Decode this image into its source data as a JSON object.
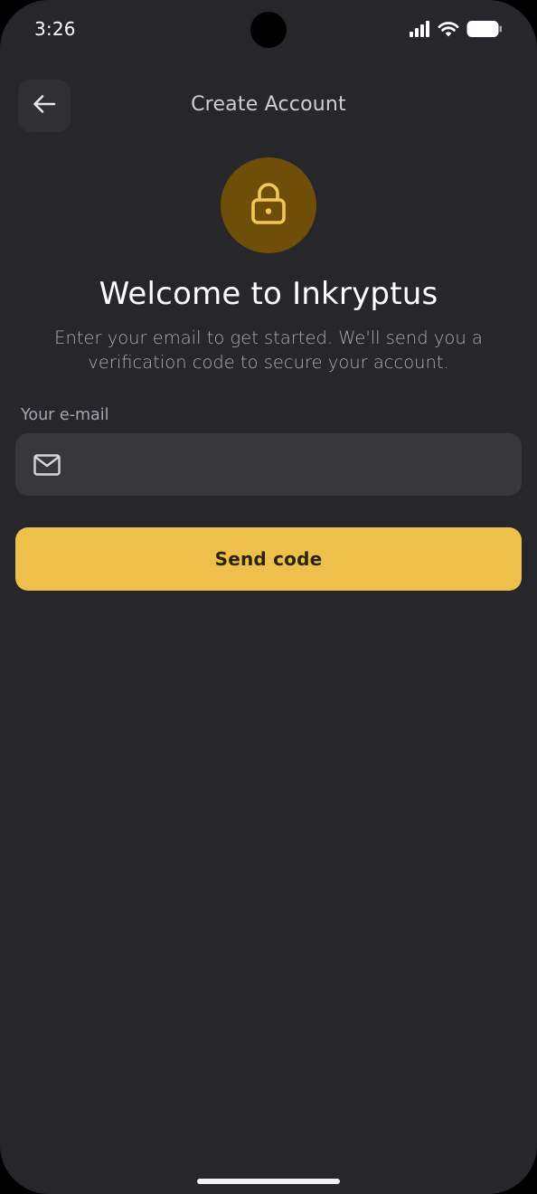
{
  "status_bar": {
    "time": "3:26",
    "icons": [
      "cellular-signal-icon",
      "wifi-icon",
      "battery-icon"
    ]
  },
  "header": {
    "back_icon": "arrow-left-icon",
    "title": "Create Account"
  },
  "hero": {
    "icon": "lock-icon",
    "title": "Welcome to Inkryptus",
    "subtitle": "Enter your email to get started. We'll send you a verification code to secure your account."
  },
  "form": {
    "email_label": "Your e-mail",
    "email_icon": "mail-icon",
    "email_value": "",
    "email_placeholder": "",
    "submit_label": "Send code"
  },
  "colors": {
    "background": "#27262b",
    "surface": "#38373c",
    "accent": "#eec04b",
    "accent_dark": "#6e4e08",
    "text_secondary": "#aeacb4"
  }
}
